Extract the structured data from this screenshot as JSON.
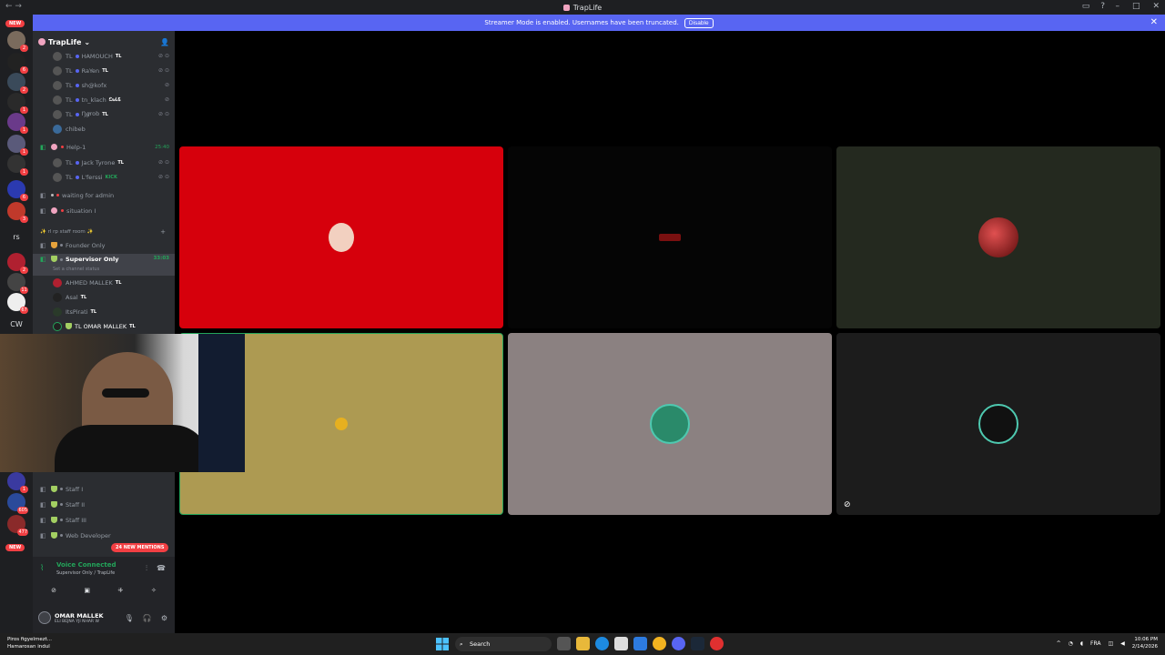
{
  "window": {
    "title": "TrapLife",
    "nav": "← →"
  },
  "banner": {
    "text": "Streamer Mode is enabled. Usernames have been truncated.",
    "disable_label": "Disable",
    "close": "✕"
  },
  "servers": {
    "new_label": "NEW",
    "badges": [
      "2",
      "6",
      "2",
      "1",
      "1",
      "1",
      "1",
      "6",
      "3",
      "2",
      "11",
      "67",
      "1"
    ],
    "rs_label": "rs",
    "cw_label": "CW",
    "lower_badges": [
      "605",
      "477"
    ],
    "lower_new": "NEW"
  },
  "guild": {
    "name": "TrapLife",
    "chevron": "⌄"
  },
  "channels": {
    "members_top": [
      {
        "prefix": "TL",
        "name": "HAMOUCH",
        "tag": "TL"
      },
      {
        "prefix": "TL",
        "name": "RaYen",
        "tag": "TL"
      },
      {
        "prefix": "TL",
        "name": "sh@kofx",
        "tag": ""
      },
      {
        "prefix": "TL",
        "name": "tn_klach",
        "tag": "ඩා𝓲ᏓᏋ"
      },
      {
        "prefix": "TL",
        "name": "Ŋ𝒈rob",
        "tag": "TL"
      },
      {
        "prefix": "",
        "name": "chibeb",
        "tag": ""
      }
    ],
    "help": {
      "name": "Help-1",
      "timer": "25:40"
    },
    "help_members": [
      {
        "prefix": "TL",
        "name": "Jack Tyrone",
        "tag": "TL"
      },
      {
        "prefix": "TL",
        "name": "L'ferssi",
        "tag": "KICK"
      }
    ],
    "waiting": "waiting for admin",
    "situation": "situation I",
    "staff_room_category": "✨ rl rp staff room ✨",
    "founder_only": "Founder Only",
    "supervisor_only": "Supervisor Only",
    "supervisor_timer": "33:03",
    "set_status": "Set a channel status",
    "supervisor_members": [
      {
        "name": "AHMED MALLEK",
        "tag": "TL"
      },
      {
        "name": "Asal",
        "tag": "TL"
      },
      {
        "name": "ItsPirati",
        "tag": "TL"
      },
      {
        "name": "TL OMAR MALLEK",
        "tag": "TL"
      }
    ],
    "staff_channels": [
      "Staff I",
      "Staff II",
      "Staff III",
      "Web Developer"
    ],
    "mentions": "24 NEW MENTIONS"
  },
  "voice": {
    "connected": "Voice Connected",
    "channel": "Supervisor Only / TrapLife"
  },
  "user": {
    "name": "OMAR MALLEK",
    "status": "ELI BEJNA YJI NHAR W"
  },
  "tiles": [
    {
      "bg": "#d6000c",
      "speaking": false
    },
    {
      "bg": "#050505",
      "speaking": false
    },
    {
      "bg": "#24291f",
      "speaking": false
    },
    {
      "bg": "#ad9a52",
      "speaking": true
    },
    {
      "bg": "#8b8181",
      "speaking": false
    },
    {
      "bg": "#1c1c1c",
      "speaking": false
    }
  ],
  "taskbar": {
    "weather_title": "Piros figyelmezt...",
    "weather_sub": "Hamarosan indul",
    "search_placeholder": "Search",
    "lang": "FRA",
    "time": "10:06 PM",
    "date": "2/14/2026"
  },
  "colors": {
    "accent": "#5865f2",
    "online": "#23a55a",
    "danger": "#f23f43"
  }
}
